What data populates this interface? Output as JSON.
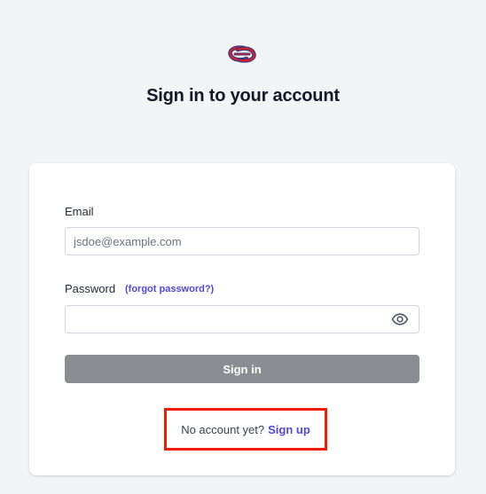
{
  "header": {
    "logo_icon": "knot-logo-icon",
    "title": "Sign in to your account"
  },
  "form": {
    "email_label": "Email",
    "email_placeholder": "jsdoe@example.com",
    "email_value": "",
    "password_label": "Password",
    "forgot_password_link": "(forgot password?)",
    "password_value": "",
    "show_password_icon": "eye-icon",
    "submit_label": "Sign in"
  },
  "footer": {
    "signup_prompt": "No account yet?",
    "signup_link": "Sign up",
    "highlight_color": "#f21c00"
  },
  "colors": {
    "background": "#f3f4f6",
    "card": "#ffffff",
    "accent": "#4f46e5",
    "button_disabled": "#8b8d92"
  }
}
